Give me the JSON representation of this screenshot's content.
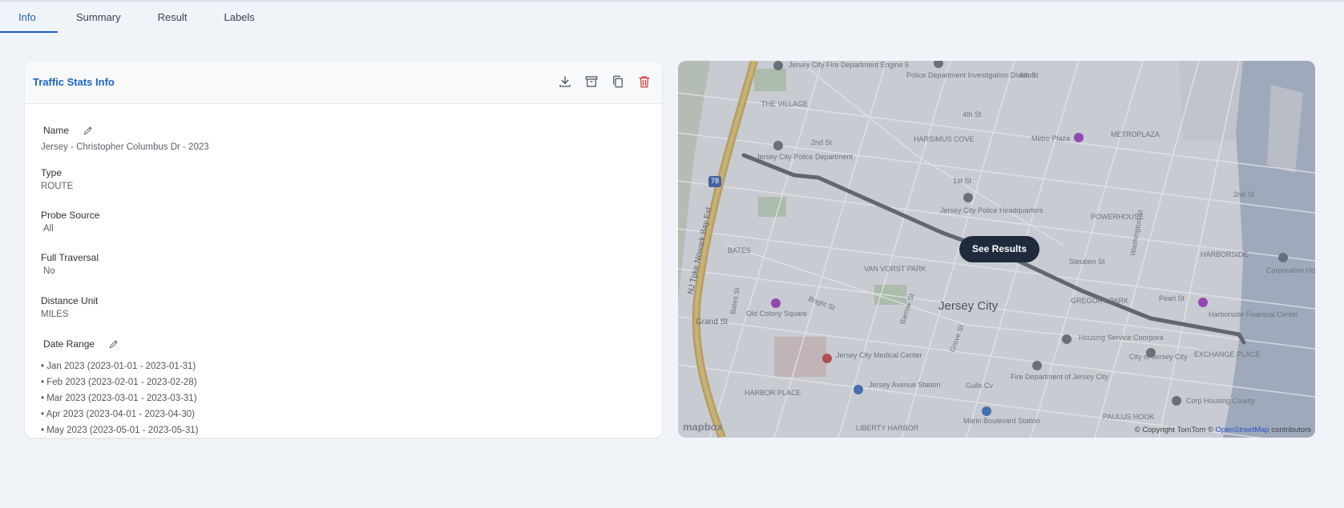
{
  "tabs": [
    {
      "label": "Info",
      "active": true
    },
    {
      "label": "Summary",
      "active": false
    },
    {
      "label": "Result",
      "active": false
    },
    {
      "label": "Labels",
      "active": false
    }
  ],
  "card": {
    "title": "Traffic Stats Info",
    "actions": [
      "download-icon",
      "archive-icon",
      "copy-icon",
      "trash-icon"
    ]
  },
  "fields": {
    "name": {
      "label": "Name",
      "value": "Jersey - Christopher Columbus Dr - 2023"
    },
    "type": {
      "label": "Type",
      "value": "ROUTE"
    },
    "probe": {
      "label": "Probe Source",
      "value": "All"
    },
    "traversal": {
      "label": "Full Traversal",
      "value": "No"
    },
    "unit": {
      "label": "Distance Unit",
      "value": "MILES"
    },
    "dates": {
      "label": "Date Range",
      "items": [
        "• Jan 2023 (2023-01-01 - 2023-01-31)",
        "• Feb 2023 (2023-02-01 - 2023-02-28)",
        "• Mar 2023 (2023-03-01 - 2023-03-31)",
        "• Apr 2023 (2023-04-01 - 2023-04-30)",
        "• May 2023 (2023-05-01 - 2023-05-31)"
      ]
    }
  },
  "map": {
    "button": "See Results",
    "logo": "mapbox",
    "copyright_prefix": "© Copyright TomTom ©",
    "copyright_link": "OpenStreetMap",
    "copyright_suffix": "contributors",
    "labels": {
      "l1": "Jersey City Fire Department Engine 5",
      "l2": "Police Department Investigation Division",
      "l3": "6th St",
      "l4": "THE VILLAGE",
      "l5": "4th St",
      "l6": "2nd St",
      "l7": "HARSIMUS COVE",
      "l8": "Metro Plaza",
      "l9": "METROPLAZA",
      "l10": "Jersey City Police Department",
      "l11": "1st St",
      "l12": "Jersey City Police Headquarters",
      "l13": "POWERHOUSE",
      "l14": "2nd St",
      "l15": "BATES",
      "l16": "VAN VORST PARK",
      "l17": "Steuben St",
      "l18": "HARBORSIDE",
      "l19": "Corporation Housing W",
      "l20": "Bates St",
      "l21": "Old Colony Square",
      "l22": "Bright St",
      "l23": "Jersey City",
      "l24": "GREGORY PARK",
      "l25": "Pearl St",
      "l26": "Harborside Financial Center",
      "l27": "Grand St",
      "l28": "Barrow St",
      "l29": "Housing Service Coorpora",
      "l30": "City of Jersey City",
      "l31": "EXCHANGE PLACE",
      "l32": "Jersey City Medical Center",
      "l33": "HARBOR PLACE",
      "l34": "Jersey Avenue Station",
      "l35": "Gulls Cv",
      "l36": "Fire Department of Jersey City",
      "l37": "Corp Housing County",
      "l38": "LIBERTY HARBOR",
      "l39": "Marin Boulevard Station",
      "l40": "PAULUS HOOK",
      "l41": "NJ Tpke Newark Bay Ext",
      "l42": "Washington St",
      "l43": "78",
      "l44": "Grove St"
    }
  }
}
